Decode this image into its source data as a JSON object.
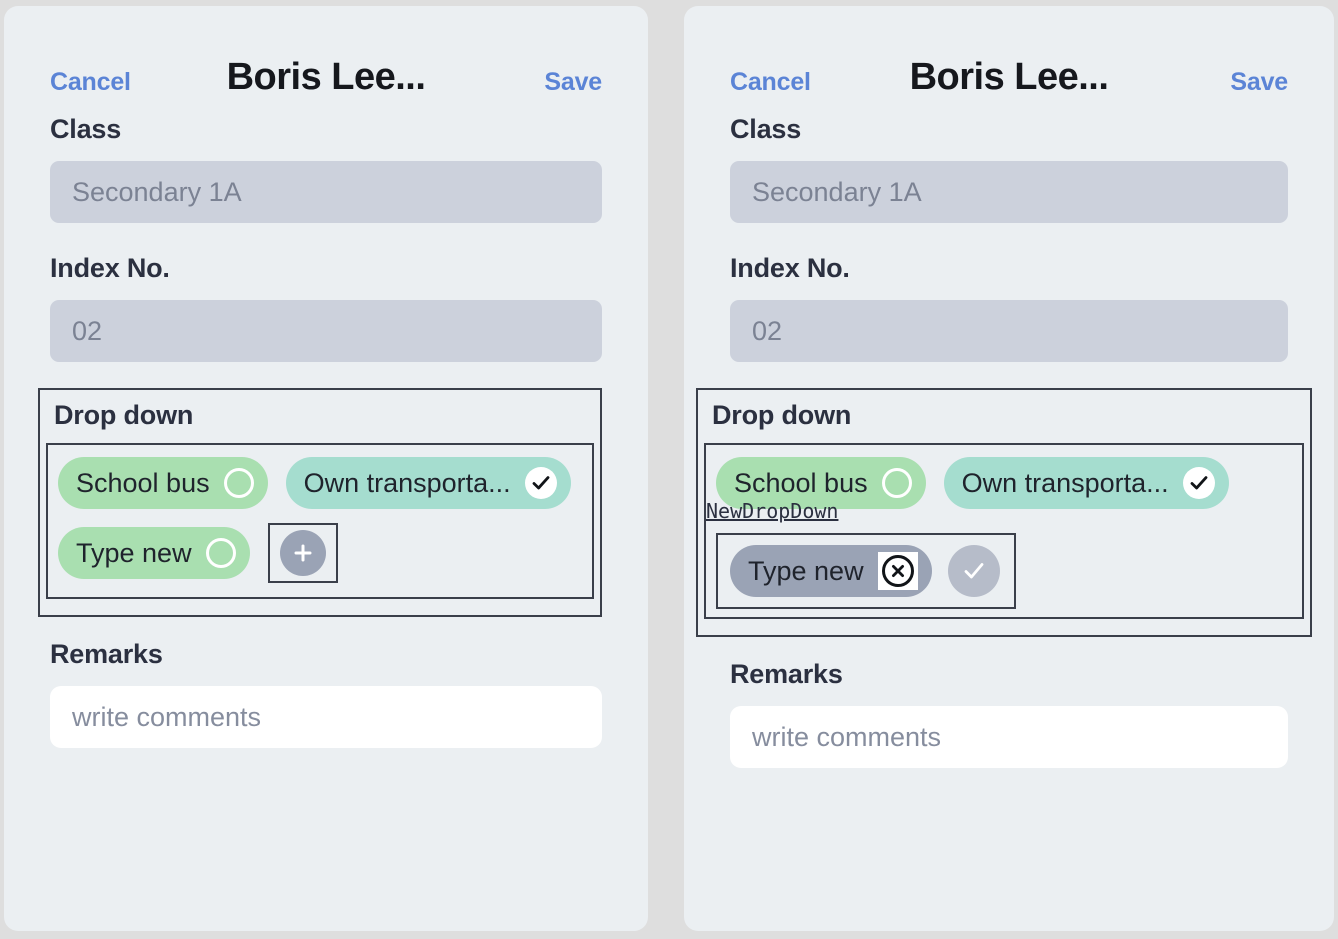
{
  "page": {
    "background_color": "#dedede",
    "panel_background": "#ebeff2"
  },
  "colors": {
    "accent_link": "#5b84d6",
    "pill_green": "#a9dfb0",
    "pill_teal": "#a5ddcf",
    "pill_gray": "#9aa3b5",
    "input_gray": "#ccd1dc",
    "annotation_border": "#3a3f4a"
  },
  "panels": [
    {
      "id": "before",
      "navbar": {
        "cancel_label": "Cancel",
        "title": "Boris Lee...",
        "save_label": "Save"
      },
      "fields": [
        {
          "label": "Class",
          "value": "Secondary 1A"
        },
        {
          "label": "Index No.",
          "value": "02"
        }
      ],
      "dropdown": {
        "title": "Drop down",
        "options": [
          {
            "label": "School bus",
            "state": "unselected",
            "style": "green",
            "indicator": "ring-icon"
          },
          {
            "label": "Own transporta...",
            "state": "selected",
            "style": "teal",
            "indicator": "check-icon"
          },
          {
            "label": "Type new",
            "state": "unselected",
            "style": "green",
            "indicator": "ring-icon"
          }
        ],
        "add_button": {
          "icon": "plus-icon",
          "label": ""
        }
      },
      "remarks": {
        "label": "Remarks",
        "placeholder": "write comments",
        "value": ""
      }
    },
    {
      "id": "after",
      "navbar": {
        "cancel_label": "Cancel",
        "title": "Boris Lee...",
        "save_label": "Save"
      },
      "fields": [
        {
          "label": "Class",
          "value": "Secondary 1A"
        },
        {
          "label": "Index No.",
          "value": "02"
        }
      ],
      "dropdown": {
        "title": "Drop down",
        "options": [
          {
            "label": "School bus",
            "state": "unselected",
            "style": "green",
            "indicator": "ring-icon"
          },
          {
            "label": "Own transporta...",
            "state": "selected",
            "style": "teal",
            "indicator": "check-icon"
          }
        ],
        "annotation": "NewDropDown",
        "new_entry": {
          "label": "Type new",
          "style": "gray",
          "clear_icon": "x-circle-icon",
          "confirm_icon": "check-icon"
        }
      },
      "remarks": {
        "label": "Remarks",
        "placeholder": "write comments",
        "value": ""
      }
    }
  ]
}
